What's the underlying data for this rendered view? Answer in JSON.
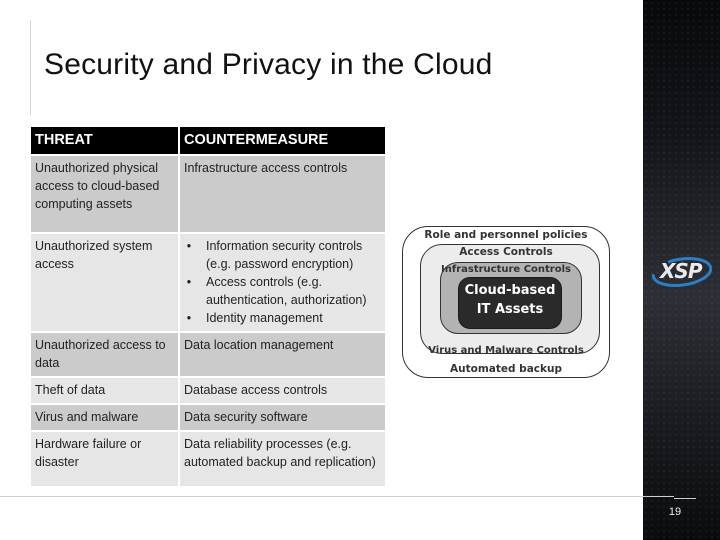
{
  "slide": {
    "title": "Security and Privacy in the Cloud",
    "page_number": "19"
  },
  "table": {
    "headers": [
      "THREAT",
      "COUNTERMEASURE"
    ],
    "rows": [
      {
        "threat": "Unauthorized physical access to cloud-based computing assets",
        "countermeasure": "Infrastructure access controls"
      },
      {
        "threat": "Unauthorized system access",
        "countermeasure_items": [
          "Information security controls (e.g. password encryption)",
          "Access controls (e.g. authentication, authorization)",
          "Identity management"
        ],
        "bullet": "•"
      },
      {
        "threat": "Unauthorized access to data",
        "countermeasure": "Data location management"
      },
      {
        "threat": "Theft of data",
        "countermeasure": "Database access controls"
      },
      {
        "threat": "Virus and malware",
        "countermeasure": "Data security software"
      },
      {
        "threat": "Hardware failure or disaster",
        "countermeasure": "Data reliability processes (e.g. automated backup and replication)"
      }
    ]
  },
  "diagram": {
    "layers_outer_to_inner": [
      {
        "top_label": "Role and personnel policies",
        "bottom_label": "Automated backup"
      },
      {
        "top_label": "Access Controls",
        "bottom_label": "Virus and Malware Controls"
      },
      {
        "top_label": "Infrastructure Controls",
        "bottom_label": ""
      }
    ],
    "core": [
      "Cloud-based",
      "IT Assets"
    ]
  },
  "branding": {
    "logo_text": "XSP",
    "logo_accent": "#2a7fc8"
  }
}
